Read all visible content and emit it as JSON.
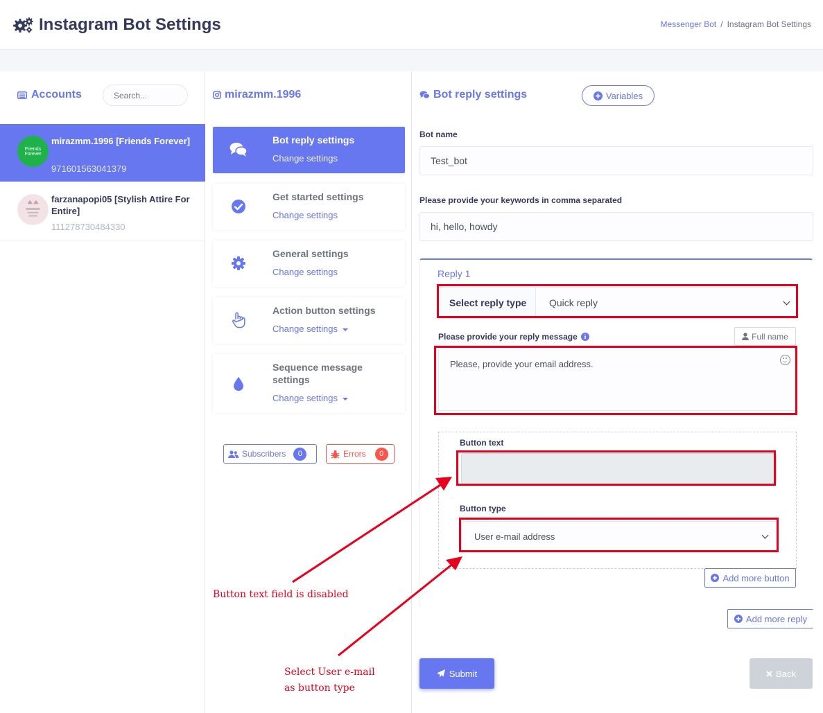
{
  "header": {
    "title": "Instagram Bot Settings",
    "breadcrumb": {
      "link": "Messenger Bot",
      "separator": "/",
      "current": "Instagram Bot Settings"
    }
  },
  "accounts_panel": {
    "title": "Accounts",
    "search_placeholder": "Search...",
    "items": [
      {
        "name": "mirazmm.1996 [Friends Forever]",
        "id": "971601563041379",
        "avatar_text": "Friends Forever",
        "active": true
      },
      {
        "name": "farzanapopi05 [Stylish Attire For Entire]",
        "id": "111278730484330",
        "avatar_text": "",
        "active": false
      }
    ]
  },
  "settings_panel": {
    "handle": "mirazmm.1996",
    "items": [
      {
        "title": "Bot reply settings",
        "sub": "Change settings",
        "icon": "comments-icon",
        "active": true,
        "caret": false
      },
      {
        "title": "Get started settings",
        "sub": "Change settings",
        "icon": "check-circle-icon",
        "active": false,
        "caret": false
      },
      {
        "title": "General settings",
        "sub": "Change settings",
        "icon": "cog-icon",
        "active": false,
        "caret": false
      },
      {
        "title": "Action button settings",
        "sub": "Change settings",
        "icon": "hand-pointer-icon",
        "active": false,
        "caret": true
      },
      {
        "title": "Sequence message settings",
        "sub": "Change settings",
        "icon": "drop-icon",
        "active": false,
        "caret": true
      }
    ],
    "subscribers": {
      "label": "Subscribers",
      "count": "0"
    },
    "errors": {
      "label": "Errors",
      "count": "0"
    }
  },
  "reply_panel": {
    "title": "Bot reply settings",
    "variables_label": "Variables",
    "bot_name_label": "Bot name",
    "bot_name_value": "Test_bot",
    "keywords_label": "Please provide your keywords in comma separated",
    "keywords_value": "hi, hello, howdy",
    "reply": {
      "tab_label": "Reply 1",
      "select_prefix": "Select reply type",
      "select_value": "Quick reply",
      "message_label": "Please provide your reply message",
      "full_name_label": "Full name",
      "message_value": "Please, provide your email address.",
      "button_text_label": "Button text",
      "button_type_label": "Button type",
      "button_type_value": "User e-mail address",
      "add_more_button": "Add more button"
    },
    "add_more_reply": "Add more reply",
    "submit_label": "Submit",
    "back_label": "Back"
  },
  "annotations": {
    "disabled_note": "Button text field is disabled",
    "select_note_line1": "Select User e-mail",
    "select_note_line2": "as button type",
    "highlight_color": "#e8001c"
  },
  "colors": {
    "primary": "#6777ef",
    "danger": "#fc544b",
    "success": "#1fb24a"
  }
}
